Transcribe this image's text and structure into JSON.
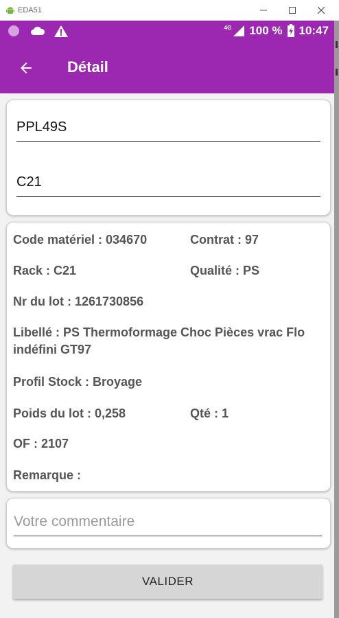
{
  "window": {
    "title": "EDA51"
  },
  "statusbar": {
    "network": "4G",
    "battery": "100 %",
    "time": "10:47"
  },
  "appbar": {
    "title": "Détail"
  },
  "inputs": {
    "lot_code": "PPL49S",
    "rack_code": "C21"
  },
  "details": {
    "code_materiel": "Code matériel : 034670",
    "contrat": "Contrat : 97",
    "rack": "Rack : C21",
    "qualite": "Qualité : PS",
    "nr_lot": "Nr du lot : 1261730856",
    "libelle": "Libellé : PS Thermoformage Choc Pièces vrac Flo indéfini  GT97",
    "profil_stock": "Profil Stock : Broyage",
    "poids_lot": "Poids du lot : 0,258",
    "qte": "Qté : 1",
    "of": "OF : 2107",
    "remarque": "Remarque :"
  },
  "comment": {
    "placeholder": "Votre commentaire"
  },
  "actions": {
    "validate_label": "VALIDER"
  },
  "colors": {
    "primary": "#9c27b0",
    "button": "#d6d6d6"
  }
}
